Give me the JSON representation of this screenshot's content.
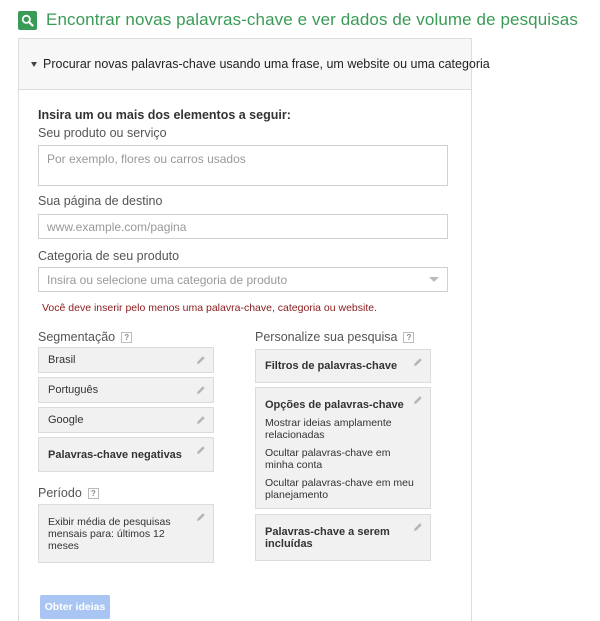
{
  "header": {
    "title": "Encontrar novas palavras-chave e ver dados de volume de pesquisas"
  },
  "section": {
    "toggle_label": "Procurar novas palavras-chave usando uma frase, um website ou uma categoria"
  },
  "form": {
    "intro": "Insira um ou mais dos elementos a seguir:",
    "product_label": "Seu produto ou serviço",
    "product_placeholder": "Por exemplo, flores ou carros usados",
    "landing_label": "Sua página de destino",
    "landing_placeholder": "www.example.com/pagina",
    "category_label": "Categoria de seu produto",
    "category_placeholder": "Insira ou selecione uma categoria de produto",
    "error": "Você deve inserir pelo menos uma palavra-chave, categoria ou website."
  },
  "targeting": {
    "heading": "Segmentação",
    "items": [
      "Brasil",
      "Português",
      "Google"
    ],
    "negative_keywords": "Palavras-chave negativas"
  },
  "period": {
    "heading": "Período",
    "text": "Exibir média de pesquisas mensais para: últimos 12 meses"
  },
  "customize": {
    "heading": "Personalize sua pesquisa",
    "keyword_filters": "Filtros de palavras-chave",
    "keyword_options": {
      "title": "Opções de palavras-chave",
      "items": [
        "Mostrar ideias amplamente relacionadas",
        "Ocultar palavras-chave em minha conta",
        "Ocultar palavras-chave em meu planejamento"
      ]
    },
    "include_keywords": "Palavras-chave a serem incluídas"
  },
  "help_glyph": "?",
  "actions": {
    "get_ideas": "Obter ideias"
  },
  "colors": {
    "brand_green": "#3a9b57",
    "error_red": "#8a1a1a",
    "button_blue": "#a9c5f3"
  }
}
